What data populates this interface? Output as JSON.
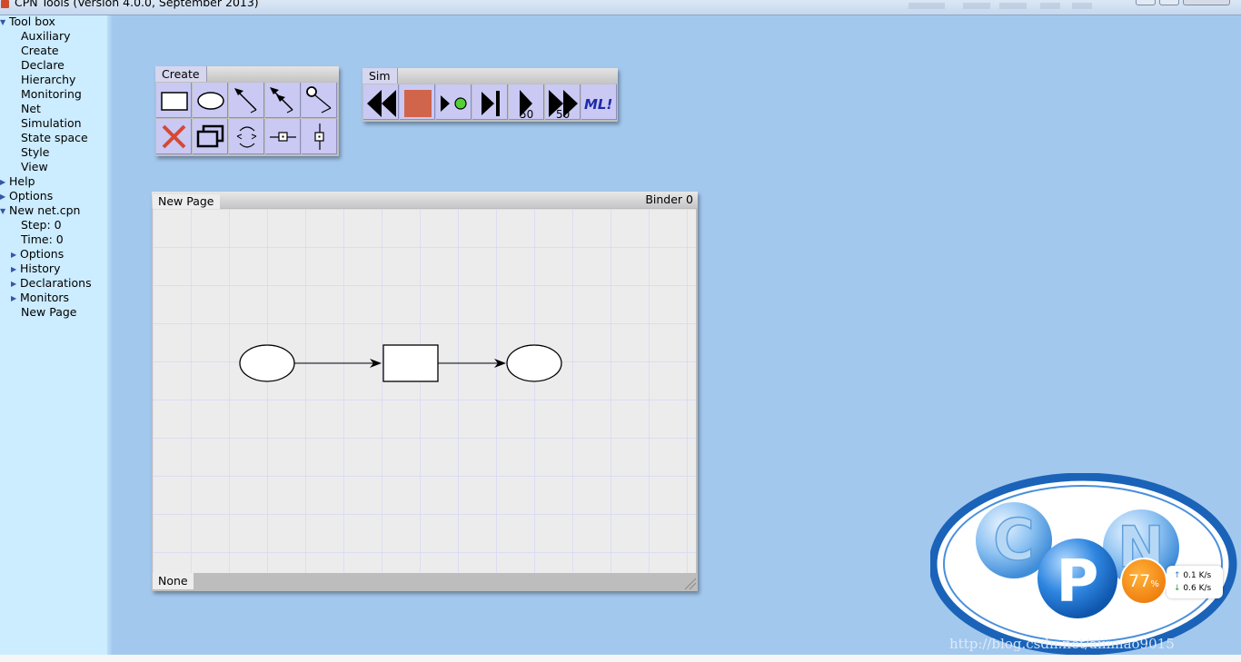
{
  "window": {
    "title": "CPN Tools (Version 4.0.0, September 2013)"
  },
  "index": {
    "toolbox_label": "Tool box",
    "toolbox_items": [
      "Auxiliary",
      "Create",
      "Declare",
      "Hierarchy",
      "Monitoring",
      "Net",
      "Simulation",
      "State space",
      "Style",
      "View"
    ],
    "help_label": "Help",
    "options_label": "Options",
    "net": {
      "name": "New net.cpn",
      "step": "Step: 0",
      "time": "Time: 0",
      "options_label": "Options",
      "history_label": "History",
      "declarations_label": "Declarations",
      "monitors_label": "Monitors",
      "page_label": "New Page"
    }
  },
  "create_palette": {
    "title": "Create",
    "tools": [
      "rectangle-transition-icon",
      "ellipse-place-icon",
      "arc-tool-icon",
      "double-arc-tool-icon",
      "reset-arc-icon",
      "delete-icon",
      "clone-icon",
      "toggle-direction-icon",
      "horizontal-guideline-icon",
      "vertical-guideline-icon"
    ]
  },
  "sim_palette": {
    "title": "Sim",
    "play_n_label": "50",
    "fast_forward_n_label": "50",
    "ml_label": "ML!",
    "tools": [
      "rewind-icon",
      "stop-icon",
      "play-single-icon",
      "step-icon",
      "play-fifty-icon",
      "fast-forward-fifty-icon",
      "evaluate-ml-icon"
    ]
  },
  "binder": {
    "page_tab": "New Page",
    "binder_name": "Binder 0",
    "status": "None"
  },
  "system_tray": {
    "cpu_value": "77",
    "cpu_unit": "%",
    "upload": "0.1 K/s",
    "download": "0.6 K/s",
    "colors": {
      "cpu": "#f08211",
      "up_arrow": "#2f7ad8",
      "down_arrow": "#2f9a3a"
    }
  },
  "logo": {
    "letters": "CPN"
  },
  "watermark": "http://blog.csdn.net/aiiimao9015",
  "colors": {
    "desktop": "#a3c8ee",
    "sidebar": "#ccecff",
    "tool_button": "#c9c9f4",
    "stop_button": "#d0654b",
    "canvas_grid": "#d8d8f8",
    "logo_blue": "#1a63b8"
  }
}
